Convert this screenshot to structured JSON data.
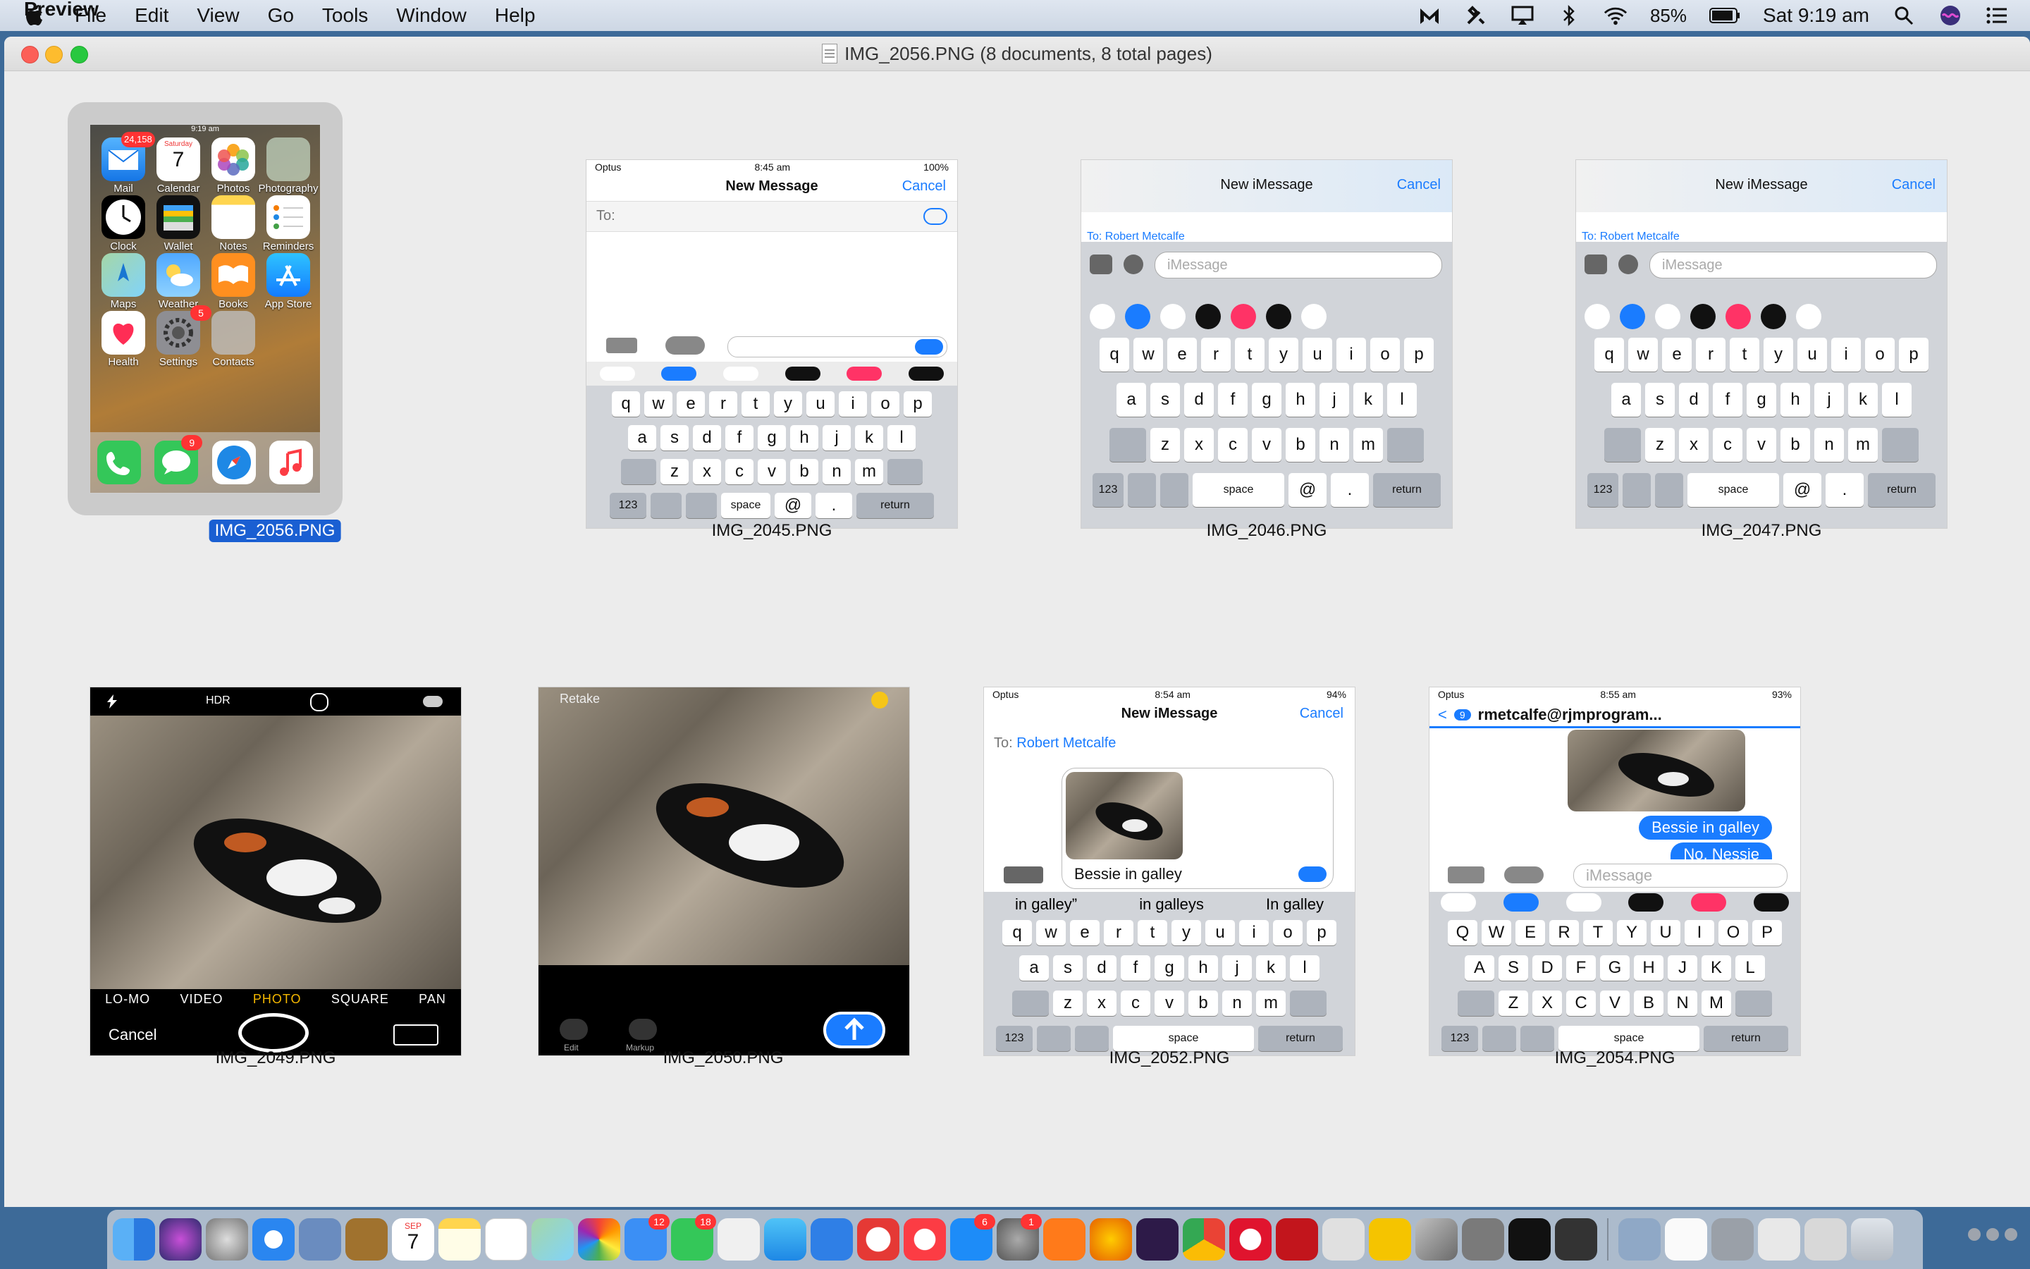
{
  "menubar": {
    "app_name": "Preview",
    "items": [
      "File",
      "Edit",
      "View",
      "Go",
      "Tools",
      "Window",
      "Help"
    ],
    "battery": "85%",
    "clock": "Sat 9:19 am"
  },
  "window": {
    "title": "IMG_2056.PNG (8 documents, 8 total pages)"
  },
  "thumbnails": [
    {
      "label": "IMG_2056.PNG",
      "selected": true
    },
    {
      "label": "IMG_2045.PNG",
      "selected": false
    },
    {
      "label": "IMG_2046.PNG",
      "selected": false
    },
    {
      "label": "IMG_2047.PNG",
      "selected": false
    },
    {
      "label": "IMG_2049.PNG",
      "selected": false
    },
    {
      "label": "IMG_2050.PNG",
      "selected": false
    },
    {
      "label": "IMG_2052.PNG",
      "selected": false
    },
    {
      "label": "IMG_2054.PNG",
      "selected": false
    }
  ],
  "home_screen": {
    "status_time": "9:19 am",
    "status_battery": "85%",
    "apps": [
      {
        "label": "Mail",
        "badge": "24,158"
      },
      {
        "label": "Calendar",
        "day_name": "Saturday",
        "day_num": "7"
      },
      {
        "label": "Photos"
      },
      {
        "label": "Photography"
      },
      {
        "label": "Clock"
      },
      {
        "label": "Wallet"
      },
      {
        "label": "Notes"
      },
      {
        "label": "Reminders"
      },
      {
        "label": "Maps"
      },
      {
        "label": "Weather"
      },
      {
        "label": "Books"
      },
      {
        "label": "App Store"
      },
      {
        "label": "Health"
      },
      {
        "label": "Settings",
        "badge": "5"
      },
      {
        "label": "Contacts"
      }
    ],
    "dock_badge_messages": "9"
  },
  "img2045": {
    "carrier": "Optus",
    "time": "8:45 am",
    "battery": "100%",
    "title": "New Message",
    "cancel": "Cancel",
    "to_label": "To:",
    "keys": [
      "space",
      "@",
      ".",
      "return",
      "123"
    ]
  },
  "img2046": {
    "title": "New iMessage",
    "cancel": "Cancel",
    "to_text": "To: Robert Metcalfe",
    "input_placeholder": "iMessage",
    "keys": [
      "space",
      "@",
      ".",
      "return",
      "123"
    ]
  },
  "img2047": {
    "title": "New iMessage",
    "cancel": "Cancel",
    "to_text": "To: Robert Metcalfe",
    "input_placeholder": "iMessage",
    "keys": [
      "space",
      "@",
      ".",
      "return",
      "123"
    ]
  },
  "img2049": {
    "hdr": "HDR",
    "modes": [
      "LO-MO",
      "VIDEO",
      "PHOTO",
      "SQUARE",
      "PAN"
    ],
    "cancel": "Cancel"
  },
  "img2050": {
    "retake": "Retake",
    "edit": "Edit",
    "markup": "Markup"
  },
  "img2052": {
    "carrier": "Optus",
    "time": "8:54 am",
    "battery": "94%",
    "title": "New iMessage",
    "cancel": "Cancel",
    "to_label": "To:",
    "to_name": "Robert Metcalfe",
    "message_text": "Bessie in galley",
    "suggestions": [
      "in galley”",
      "in galleys",
      "In galley"
    ],
    "keys": [
      "space",
      "return",
      "123"
    ]
  },
  "img2054": {
    "carrier": "Optus",
    "time": "8:55 am",
    "battery": "93%",
    "contact": "rmetcalfe@rjmprogram...",
    "back_count": "9",
    "bubble1": "Bessie in galley",
    "bubble2": "No, Nessie",
    "input_placeholder": "iMessage",
    "keys": [
      "space",
      "return",
      "123"
    ]
  },
  "keyboard": {
    "row1": [
      "q",
      "w",
      "e",
      "r",
      "t",
      "y",
      "u",
      "i",
      "o",
      "p"
    ],
    "row2": [
      "a",
      "s",
      "d",
      "f",
      "g",
      "h",
      "j",
      "k",
      "l"
    ],
    "row3": [
      "z",
      "x",
      "c",
      "v",
      "b",
      "n",
      "m"
    ],
    "row1_upper": [
      "Q",
      "W",
      "E",
      "R",
      "T",
      "Y",
      "U",
      "I",
      "O",
      "P"
    ],
    "row2_upper": [
      "A",
      "S",
      "D",
      "F",
      "G",
      "H",
      "J",
      "K",
      "L"
    ],
    "row3_upper": [
      "Z",
      "X",
      "C",
      "V",
      "B",
      "N",
      "M"
    ]
  },
  "dock": {
    "calendar_month": "SEP",
    "calendar_day": "7",
    "badges": {
      "mail": "12",
      "facetime": "18",
      "appstore": "6",
      "prefs": "1"
    }
  },
  "colors": {
    "accent": "#1a5fd2",
    "ios_blue": "#1a7cff",
    "desktop": "#3d6a98"
  }
}
